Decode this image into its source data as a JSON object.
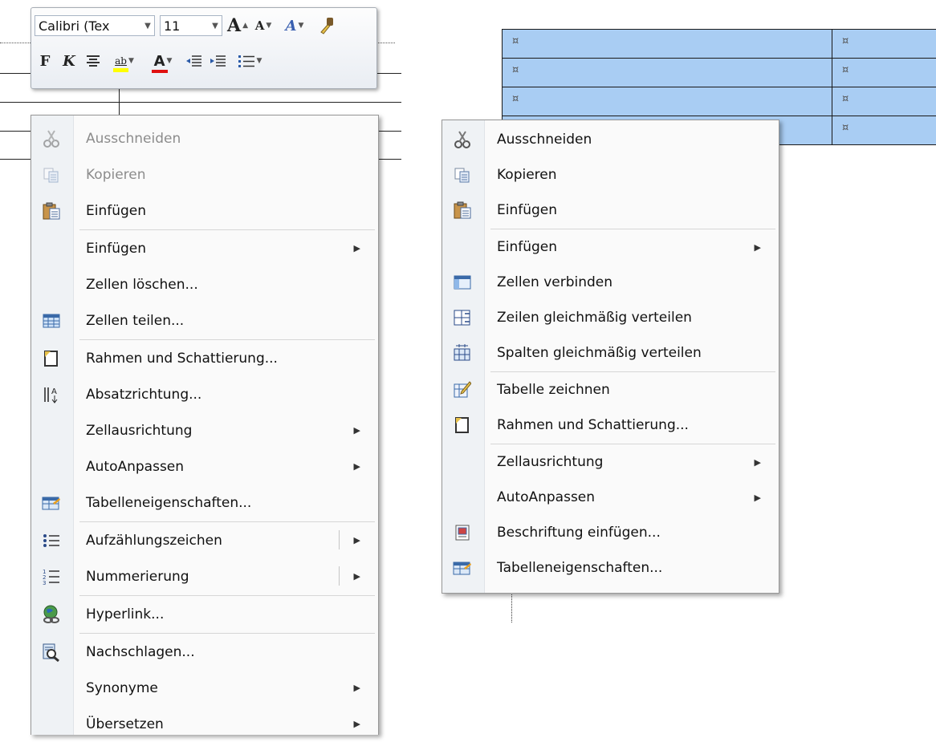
{
  "mini_toolbar": {
    "font_name": "Calibri (Tex",
    "font_size": "11",
    "grow_font": "A",
    "shrink_font": "A",
    "bold": "F",
    "italic": "K",
    "font_color_letter": "A",
    "highlight_letters": "ab",
    "highlight_color": "#ffff00",
    "font_color": "#e01010"
  },
  "left_menu": {
    "items": [
      {
        "label": "Ausschneiden",
        "icon": "scissors-icon",
        "disabled": true
      },
      {
        "label": "Kopieren",
        "icon": "copy-icon",
        "disabled": true
      },
      {
        "label": "Einfügen",
        "icon": "paste-icon"
      },
      {
        "label": "Einfügen",
        "submenu": true
      },
      {
        "label": "Zellen löschen..."
      },
      {
        "label": "Zellen teilen...",
        "icon": "split-cells-icon"
      },
      {
        "label": "Rahmen und Schattierung...",
        "icon": "borders-icon"
      },
      {
        "label": "Absatzrichtung...",
        "icon": "text-direction-icon"
      },
      {
        "label": "Zellausrichtung",
        "submenu": true
      },
      {
        "label": "AutoAnpassen",
        "submenu": true
      },
      {
        "label": "Tabelleneigenschaften...",
        "icon": "table-properties-icon"
      },
      {
        "label": "Aufzählungszeichen",
        "icon": "bullets-icon",
        "submenu": true
      },
      {
        "label": "Nummerierung",
        "icon": "numbering-icon",
        "submenu": true
      },
      {
        "label": "Hyperlink...",
        "icon": "hyperlink-icon"
      },
      {
        "label": "Nachschlagen...",
        "icon": "research-icon"
      },
      {
        "label": "Synonyme",
        "submenu": true
      },
      {
        "label": "Übersetzen",
        "submenu": true
      }
    ]
  },
  "right_menu": {
    "items": [
      {
        "label": "Ausschneiden",
        "icon": "scissors-icon"
      },
      {
        "label": "Kopieren",
        "icon": "copy-icon"
      },
      {
        "label": "Einfügen",
        "icon": "paste-icon"
      },
      {
        "label": "Einfügen",
        "submenu": true
      },
      {
        "label": "Zellen verbinden",
        "icon": "merge-cells-icon"
      },
      {
        "label": "Zeilen gleichmäßig verteilen",
        "icon": "distribute-rows-icon"
      },
      {
        "label": "Spalten gleichmäßig verteilen",
        "icon": "distribute-columns-icon"
      },
      {
        "label": "Tabelle zeichnen",
        "icon": "draw-table-icon"
      },
      {
        "label": "Rahmen und Schattierung...",
        "icon": "borders-icon"
      },
      {
        "label": "Zellausrichtung",
        "submenu": true
      },
      {
        "label": "AutoAnpassen",
        "submenu": true
      },
      {
        "label": "Beschriftung einfügen...",
        "icon": "caption-icon"
      },
      {
        "label": "Tabelleneigenschaften...",
        "icon": "table-properties-icon"
      }
    ]
  },
  "table": {
    "cell_mark": "¤",
    "selection_color": "#a9cdf3"
  },
  "submenu_arrow": "▶"
}
